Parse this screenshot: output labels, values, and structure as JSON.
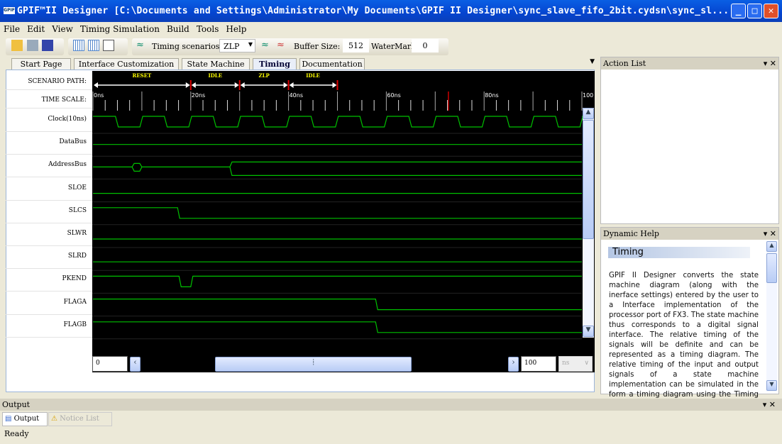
{
  "window": {
    "title": "GPIF™II Designer [C:\\Documents and Settings\\Administrator\\My Documents\\GPIF II Designer\\sync_slave_fifo_2bit.cydsn\\sync_sl...",
    "app_icon": "GPIF",
    "buttons": [
      "minimize",
      "maximize",
      "close"
    ]
  },
  "menu": [
    "File",
    "Edit",
    "View",
    "Timing Simulation",
    "Build",
    "Tools",
    "Help"
  ],
  "toolbar": {
    "timing_scenarios_label": "Timing scenarios:",
    "timing_scenario_value": "ZLP",
    "buffer_size_label": "Buffer Size:",
    "buffer_size_value": "512",
    "watermark_label": "WaterMark:",
    "watermark_value": "0"
  },
  "tabs": [
    {
      "label": "Start Page"
    },
    {
      "label": "Interface Customization"
    },
    {
      "label": "State Machine"
    },
    {
      "label": "Timing",
      "active": true
    },
    {
      "label": "Documentation"
    }
  ],
  "timing": {
    "scenario_path_label": "SCENARIO PATH:",
    "time_scale_label": "TIME SCALE:",
    "scenario_path": [
      {
        "name": "RESET",
        "start": 0,
        "end": 20
      },
      {
        "name": "IDLE",
        "start": 20,
        "end": 30
      },
      {
        "name": "ZLP",
        "start": 30,
        "end": 40
      },
      {
        "name": "IDLE",
        "start": 40,
        "end": 50
      }
    ],
    "time_ticks": [
      "0ns",
      "20ns",
      "40ns",
      "60ns",
      "80ns",
      "100"
    ],
    "time_range_ns": [
      0,
      100
    ],
    "marker_ns": 72.7,
    "wave_color": "#00c000",
    "signals": [
      {
        "name": "Clock(10ns)",
        "type": "clock",
        "period": 10,
        "first_fall": 4.6
      },
      {
        "name": "DataBus",
        "type": "flat",
        "level": 0.5
      },
      {
        "name": "AddressBus",
        "type": "bus",
        "bubbles": [
          [
            8,
            10
          ]
        ],
        "valid_from": 28
      },
      {
        "name": "SLOE",
        "type": "flat",
        "level": 0.8
      },
      {
        "name": "SLCS",
        "type": "steps",
        "init": 1,
        "edges": [
          17.3
        ]
      },
      {
        "name": "SLWR",
        "type": "flat",
        "level": 0.8
      },
      {
        "name": "SLRD",
        "type": "flat",
        "level": 0.8
      },
      {
        "name": "PKEND",
        "type": "steps",
        "init": 1,
        "edges": [
          17.6,
          20
        ]
      },
      {
        "name": "FLAGA",
        "type": "steps",
        "init": 1,
        "edges": [
          57.8
        ]
      },
      {
        "name": "FLAGB",
        "type": "steps",
        "init": 1,
        "edges": [
          57.8
        ]
      }
    ],
    "range_start": "0",
    "range_end": "100",
    "unit": "ns",
    "hscroll_fraction": [
      0.2,
      0.74
    ]
  },
  "action_list": {
    "title": "Action List"
  },
  "dynamic_help": {
    "title": "Dynamic Help",
    "heading": "Timing",
    "text": "GPIF II Designer converts the state machine diagram (along with the inerface settings) entered by the user to a Interface implementation of the processor port of FX3. The state machine thus corresponds to a digital signal interface. The relative timing of the signals will be definite and can be represented as a timing diagram. The relative timing of the input and output signals of a state machine implementation can be simulated in the form a timing diagram using the Timing Window."
  },
  "output": {
    "title": "Output",
    "tabs": [
      "Output",
      "Notice List"
    ]
  },
  "status": "Ready"
}
